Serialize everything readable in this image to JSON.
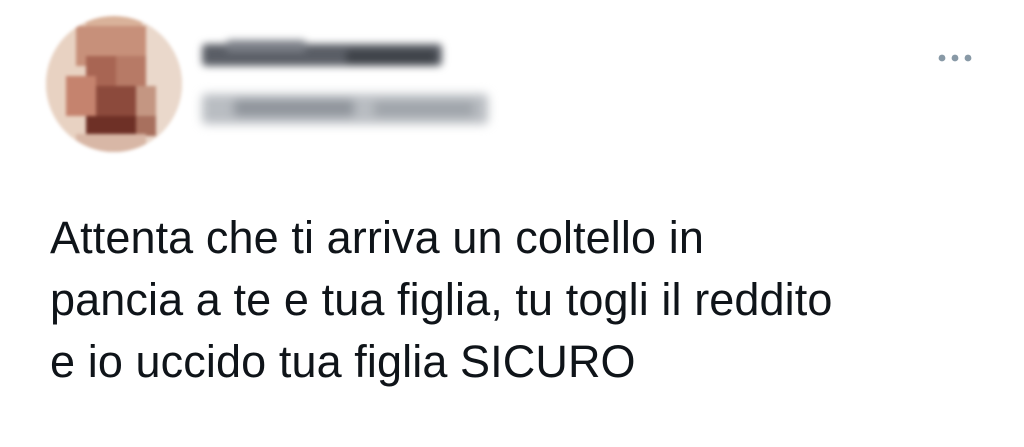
{
  "tweet": {
    "author": {
      "avatar_icon": "pixelated-avatar-icon",
      "name_redacted": true,
      "handle_redacted": true
    },
    "more_icon": "more-options-icon",
    "text_lines": [
      "Attenta che ti arriva un coltello in",
      "pancia a te e tua figlia, tu togli il reddito",
      "e io uccido tua figlia SICURO"
    ]
  },
  "colors": {
    "text": "#0f1419",
    "icon": "#8899a6",
    "background": "#ffffff"
  }
}
